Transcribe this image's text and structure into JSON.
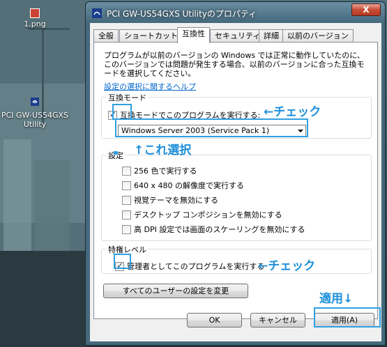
{
  "desktop": {
    "icons": [
      {
        "label": "1.png"
      },
      {
        "label": "PCI GW-US54GXS\nUtility"
      }
    ]
  },
  "window": {
    "title": "PCI GW-US54GXS Utilityのプロパティ",
    "close_label": "X"
  },
  "tabs": [
    {
      "label": "全般"
    },
    {
      "label": "ショートカット"
    },
    {
      "label": "互換性"
    },
    {
      "label": "セキュリティ"
    },
    {
      "label": "詳細"
    },
    {
      "label": "以前のバージョン"
    }
  ],
  "compat": {
    "description": "プログラムが以前のバージョンの Windows では正常に動作していたのに、このバージョンでは問題が発生する場合、以前のバージョンに合った互換モードを選択してください。",
    "help_link": "設定の選択に関するヘルプ",
    "mode_group_label": "互換モード",
    "mode_checkbox_label": "互換モードでこのプログラムを実行する:",
    "mode_select_value": "Windows Server 2003 (Service Pack 1)",
    "settings_group_label": "設定",
    "settings_options": [
      "256 色で実行する",
      "640 x 480 の解像度で実行する",
      "視覚テーマを無効にする",
      "デスクトップ コンポジションを無効にする",
      "高 DPI 設定では画面のスケーリングを無効にする"
    ],
    "priv_group_label": "特権レベル",
    "admin_checkbox_label": "管理者としてこのプログラムを実行する",
    "all_users_button": "すべてのユーザーの設定を変更"
  },
  "buttons": {
    "ok": "OK",
    "cancel": "キャンセル",
    "apply": "適用(A)"
  },
  "annotations": {
    "check1": "←チェック",
    "select_note": "↑これ選択",
    "check2": "←チェック",
    "apply_note": "適用↓"
  },
  "colors": {
    "annotation": "#1e8fd8",
    "highlight": "#2f9fe0"
  }
}
